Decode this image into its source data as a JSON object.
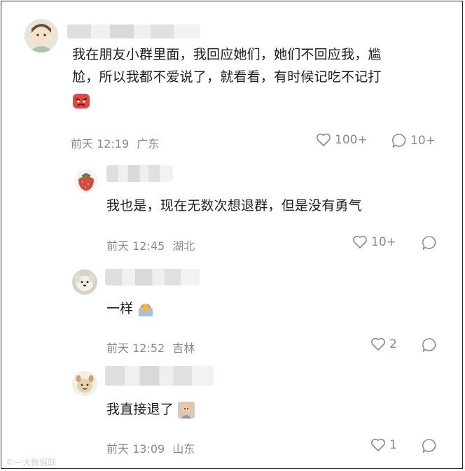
{
  "comments": [
    {
      "text_line1": "我在朋友小群里面，我回应她们，她们不回应我，尴",
      "text_line2": "尬，所以我都不爱说了，就看看，有时候记吃不记打",
      "emoji": "angry-face-emoji",
      "time": "前天 12:19",
      "location": "广东",
      "likes": "100+",
      "replies": "10+"
    },
    {
      "text": "我也是，现在无数次想退群，但是没有勇气",
      "time": "前天 12:45",
      "location": "湖北",
      "likes": "10+",
      "replies": ""
    },
    {
      "text": "一样",
      "emoji": "sweat-emoji",
      "time": "前天 12:52",
      "location": "吉林",
      "likes": "2",
      "replies": ""
    },
    {
      "text": "我直接退了",
      "emoji": "sticker-image",
      "time": "前天 13:09",
      "location": "山东",
      "likes": "1",
      "replies": ""
    }
  ],
  "watermark": "©一大数据联",
  "colors": {
    "text": "#1d1d1d",
    "meta": "#8a8a8a",
    "border": "#2b2b2b"
  }
}
